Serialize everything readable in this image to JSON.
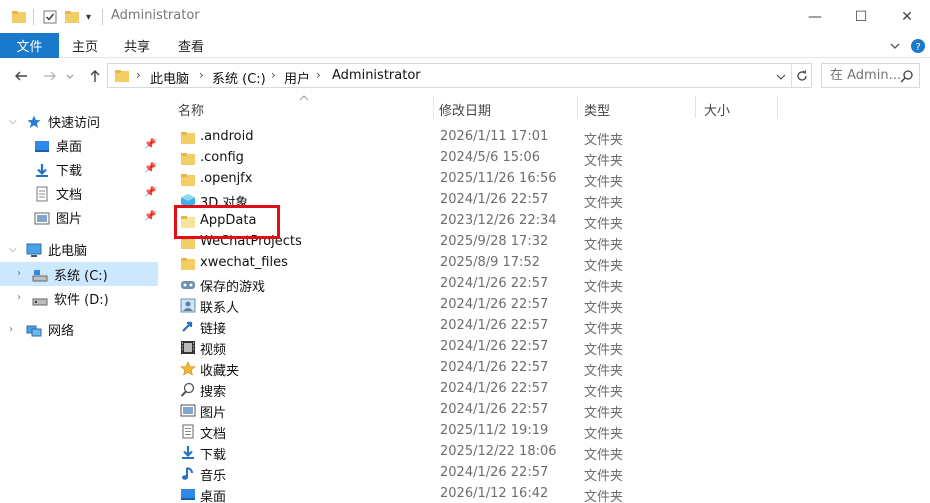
{
  "window": {
    "title": "Administrator",
    "controls": {
      "minimize": "—",
      "maximize": "☐",
      "close": "✕"
    }
  },
  "ribbon": {
    "tabs": [
      {
        "label": "文件"
      },
      {
        "label": "主页"
      },
      {
        "label": "共享"
      },
      {
        "label": "查看"
      }
    ]
  },
  "address": {
    "crumbs": [
      "此电脑",
      "系统 (C:)",
      "用户",
      "Administrator"
    ],
    "search_placeholder": "在 Admin..."
  },
  "nav": {
    "quick_access": "快速访问",
    "quick_items": [
      "桌面",
      "下载",
      "文档",
      "图片"
    ],
    "this_pc": "此电脑",
    "drives": [
      "系统 (C:)",
      "软件 (D:)"
    ],
    "network": "网络"
  },
  "columns": {
    "name": "名称",
    "date": "修改日期",
    "type": "类型",
    "size": "大小"
  },
  "files": [
    {
      "name": ".android",
      "date": "2026/1/11 17:01",
      "type": "文件夹",
      "icon": "folder-icon"
    },
    {
      "name": ".config",
      "date": "2024/5/6 15:06",
      "type": "文件夹",
      "icon": "folder-icon"
    },
    {
      "name": ".openjfx",
      "date": "2025/11/26 16:56",
      "type": "文件夹",
      "icon": "folder-icon"
    },
    {
      "name": "3D 对象",
      "date": "2024/1/26 22:57",
      "type": "文件夹",
      "icon": "3d-objects-icon"
    },
    {
      "name": "AppData",
      "date": "2023/12/26 22:34",
      "type": "文件夹",
      "icon": "folder-icon"
    },
    {
      "name": "WeChatProjects",
      "date": "2025/9/28 17:32",
      "type": "文件夹",
      "icon": "folder-icon"
    },
    {
      "name": "xwechat_files",
      "date": "2025/8/9 17:52",
      "type": "文件夹",
      "icon": "folder-icon"
    },
    {
      "name": "保存的游戏",
      "date": "2024/1/26 22:57",
      "type": "文件夹",
      "icon": "saved-games-icon"
    },
    {
      "name": "联系人",
      "date": "2024/1/26 22:57",
      "type": "文件夹",
      "icon": "contacts-icon"
    },
    {
      "name": "链接",
      "date": "2024/1/26 22:57",
      "type": "文件夹",
      "icon": "links-icon"
    },
    {
      "name": "视频",
      "date": "2024/1/26 22:57",
      "type": "文件夹",
      "icon": "videos-icon"
    },
    {
      "name": "收藏夹",
      "date": "2024/1/26 22:57",
      "type": "文件夹",
      "icon": "favorites-icon"
    },
    {
      "name": "搜索",
      "date": "2024/1/26 22:57",
      "type": "文件夹",
      "icon": "searches-icon"
    },
    {
      "name": "图片",
      "date": "2024/1/26 22:57",
      "type": "文件夹",
      "icon": "pictures-icon"
    },
    {
      "name": "文档",
      "date": "2025/11/2 19:19",
      "type": "文件夹",
      "icon": "documents-icon"
    },
    {
      "name": "下载",
      "date": "2025/12/22 18:06",
      "type": "文件夹",
      "icon": "downloads-icon"
    },
    {
      "name": "音乐",
      "date": "2024/1/26 22:57",
      "type": "文件夹",
      "icon": "music-icon"
    },
    {
      "name": "桌面",
      "date": "2026/1/12 16:42",
      "type": "文件夹",
      "icon": "desktop-icon"
    }
  ],
  "colors": {
    "file_tab": "#1979ca",
    "selected_nav": "#cce8ff",
    "highlight_box": "#e10e18"
  }
}
